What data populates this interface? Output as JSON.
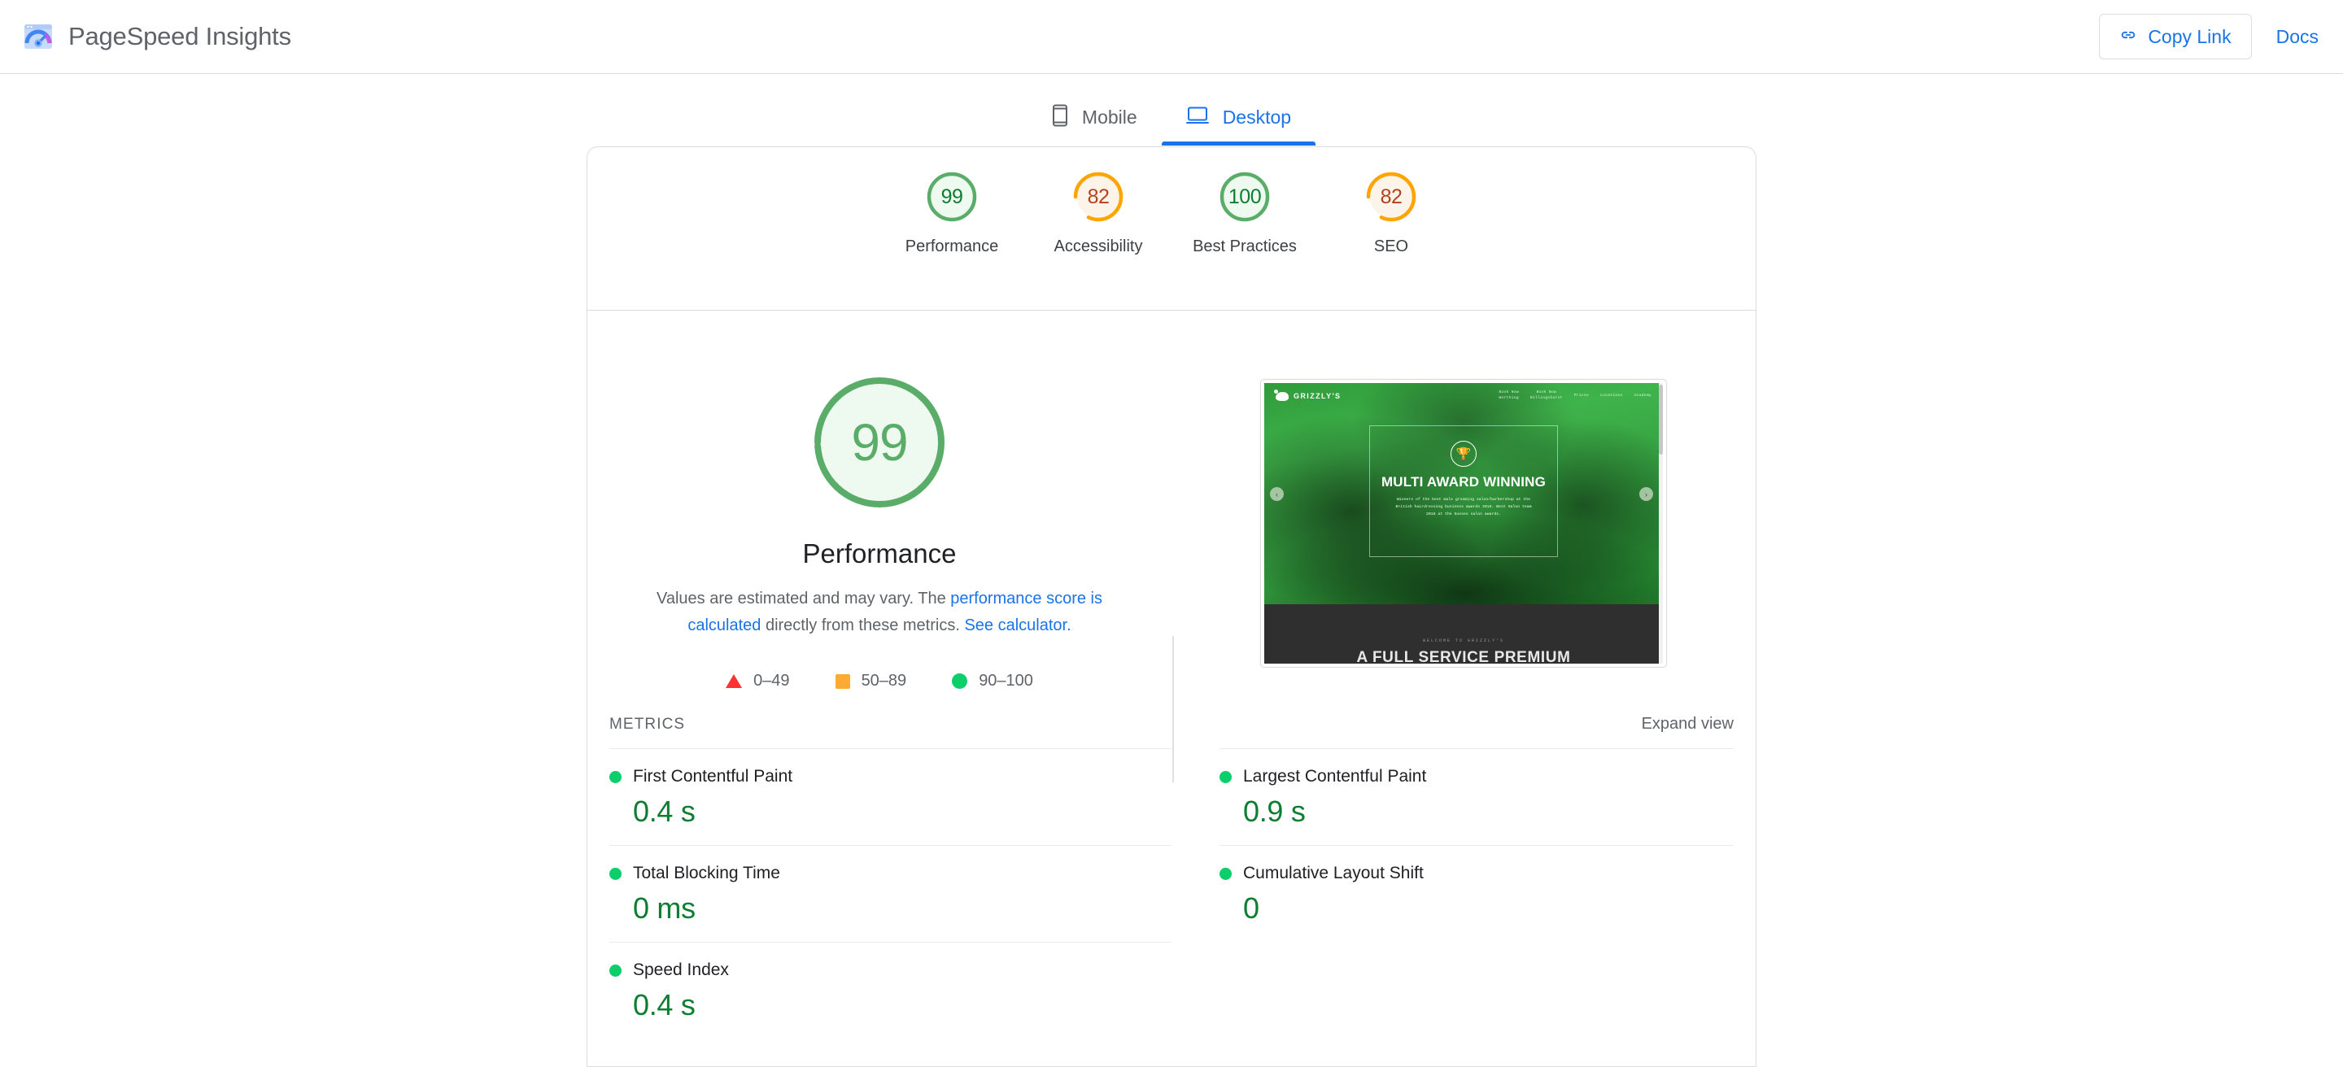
{
  "header": {
    "logo_icon": "pagespeed-logo-icon",
    "title": "PageSpeed Insights",
    "copy_link_label": "Copy Link",
    "copy_link_icon": "link-icon",
    "docs_label": "Docs"
  },
  "tabs": [
    {
      "label": "Mobile",
      "icon": "mobile-phone-icon",
      "active": false
    },
    {
      "label": "Desktop",
      "icon": "desktop-monitor-icon",
      "active": true
    }
  ],
  "scores": [
    {
      "name": "Performance",
      "value": "99",
      "percent": 99,
      "status": "green"
    },
    {
      "name": "Accessibility",
      "value": "82",
      "percent": 82,
      "status": "orange"
    },
    {
      "name": "Best Practices",
      "value": "100",
      "percent": 100,
      "status": "green"
    },
    {
      "name": "SEO",
      "value": "82",
      "percent": 82,
      "status": "orange"
    }
  ],
  "hero": {
    "score_value": "99",
    "score_percent": 99,
    "score_status": "green",
    "score_label": "Performance",
    "desc_part1": "Values are estimated and may vary. The ",
    "desc_link1": "performance score is calculated",
    "desc_part2": " directly from these metrics. ",
    "desc_link2": "See calculator.",
    "legend": [
      {
        "shape": "triangle",
        "color": "#ff3333",
        "range": "0–49"
      },
      {
        "shape": "square",
        "color": "#ffaa33",
        "range": "50–89"
      },
      {
        "shape": "circle",
        "color": "#0cce6b",
        "range": "90–100"
      }
    ]
  },
  "thumbnail": {
    "site_brand": "GRIZZLY'S",
    "nav_links": [
      "Book Now\nWorthing",
      "Book Now\nBillingshurst",
      "Prices",
      "Locations",
      "Academy"
    ],
    "trophy_icon": "trophy-icon",
    "award_title": "MULTI AWARD\nWINNING",
    "award_sub": "Winners of the best male grooming salon/barbershop at the British hairdressing business awards 2019. Best Salon team 2018 at the Sussex salon awards.",
    "prev_arrow": "‹",
    "next_arrow": "›",
    "lower_eyebrow": "WELCOME TO GRIZZLY'S",
    "lower_head": "A FULL SERVICE PREMIUM"
  },
  "metrics": {
    "section_title": "METRICS",
    "expand_label": "Expand view",
    "left": [
      {
        "name": "First Contentful Paint",
        "value": "0.4 s",
        "status": "green"
      },
      {
        "name": "Total Blocking Time",
        "value": "0 ms",
        "status": "green"
      },
      {
        "name": "Speed Index",
        "value": "0.4 s",
        "status": "green"
      }
    ],
    "right": [
      {
        "name": "Largest Contentful Paint",
        "value": "0.9 s",
        "status": "green"
      },
      {
        "name": "Cumulative Layout Shift",
        "value": "0",
        "status": "green"
      }
    ]
  },
  "colors": {
    "green": "#0cce6b",
    "green_ring": "#5aad69",
    "green_text": "#0c7e32",
    "orange": "#ffa400",
    "orange_text": "#b3411e",
    "red": "#ff3333",
    "blue": "#1a73e8",
    "border": "#dadce0"
  }
}
